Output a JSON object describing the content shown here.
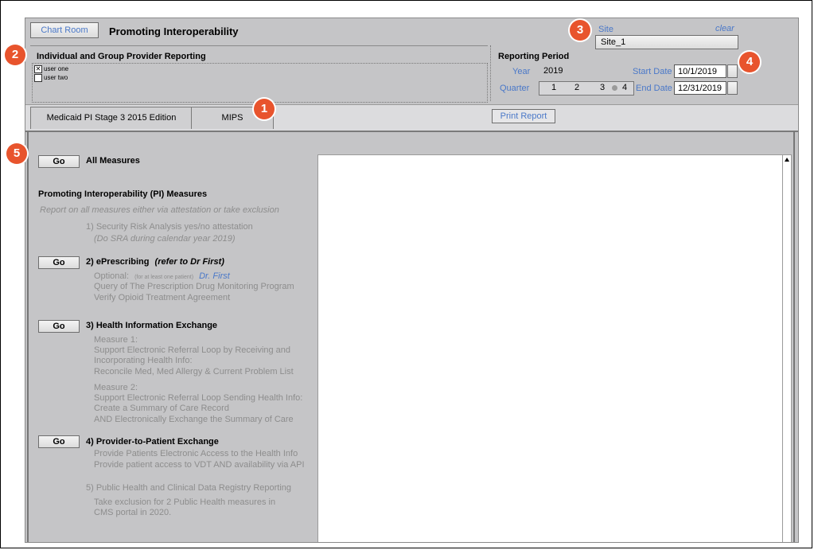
{
  "header": {
    "chart_room_label": "Chart Room",
    "title": "Promoting Interoperability"
  },
  "provider_panel": {
    "title": "Individual and Group Provider Reporting",
    "users": [
      {
        "label": "user one",
        "checked": true
      },
      {
        "label": "user two",
        "checked": false
      }
    ]
  },
  "site": {
    "label": "Site",
    "clear_label": "clear",
    "value": "Site_1"
  },
  "reporting": {
    "title": "Reporting Period",
    "year_label": "Year",
    "year_value": "2019",
    "quarter_label": "Quarter",
    "quarters": [
      "1",
      "2",
      "3",
      "4"
    ],
    "selected_quarter": "4",
    "start_label": "Start Date",
    "start_value": "10/1/2019",
    "end_label": "End Date",
    "end_value": "12/31/2019"
  },
  "tabs": [
    {
      "label": "Medicaid PI Stage 3 2015 Edition"
    },
    {
      "label": "MIPS"
    }
  ],
  "print_report_label": "Print Report",
  "go_label": "Go",
  "all_measures_label": "All Measures",
  "measures": {
    "title": "Promoting Interoperability (PI) Measures",
    "subtitle": "Report on all measures either via attestation or take exclusion",
    "m1_line1": "1) Security Risk Analysis yes/no attestation",
    "m1_line2": "(Do SRA during calendar year 2019)",
    "m2_title": "2) ePrescribing",
    "m2_note": "(refer to Dr First)",
    "m2_optional": "Optional:",
    "m2_optional_note": "(for at least one patient)",
    "m2_link": "Dr. First",
    "m2_line2": "Query of The Prescription Drug Monitoring Program",
    "m2_line3": "Verify Opioid Treatment Agreement",
    "m3_title": "3) Health Information Exchange",
    "m3_lines": [
      "Measure 1:",
      "Support Electronic Referral Loop by Receiving and",
      "Incorporating Health Info:",
      "Reconcile Med, Med Allergy & Current Problem List"
    ],
    "m3_lines_b": [
      "Measure 2:",
      "Support Electronic Referral Loop Sending Health Info:",
      "Create a Summary of Care Record",
      "AND Electronically Exchange the Summary of Care"
    ],
    "m4_title": "4) Provider-to-Patient Exchange",
    "m4_lines": [
      "Provide Patients Electronic Access to the Health Info",
      "Provide patient access to VDT  AND availability via API"
    ],
    "m5_title": "5) Public Health and Clinical Data Registry Reporting",
    "m5_lines": [
      "Take exclusion for 2 Public Health measures in",
      "CMS portal in 2020."
    ]
  },
  "badges": [
    "1",
    "2",
    "3",
    "4",
    "5"
  ],
  "colors": {
    "badge": "#e8542d",
    "link_blue": "#4a78c8",
    "panel_gray": "#c5c5c7"
  }
}
